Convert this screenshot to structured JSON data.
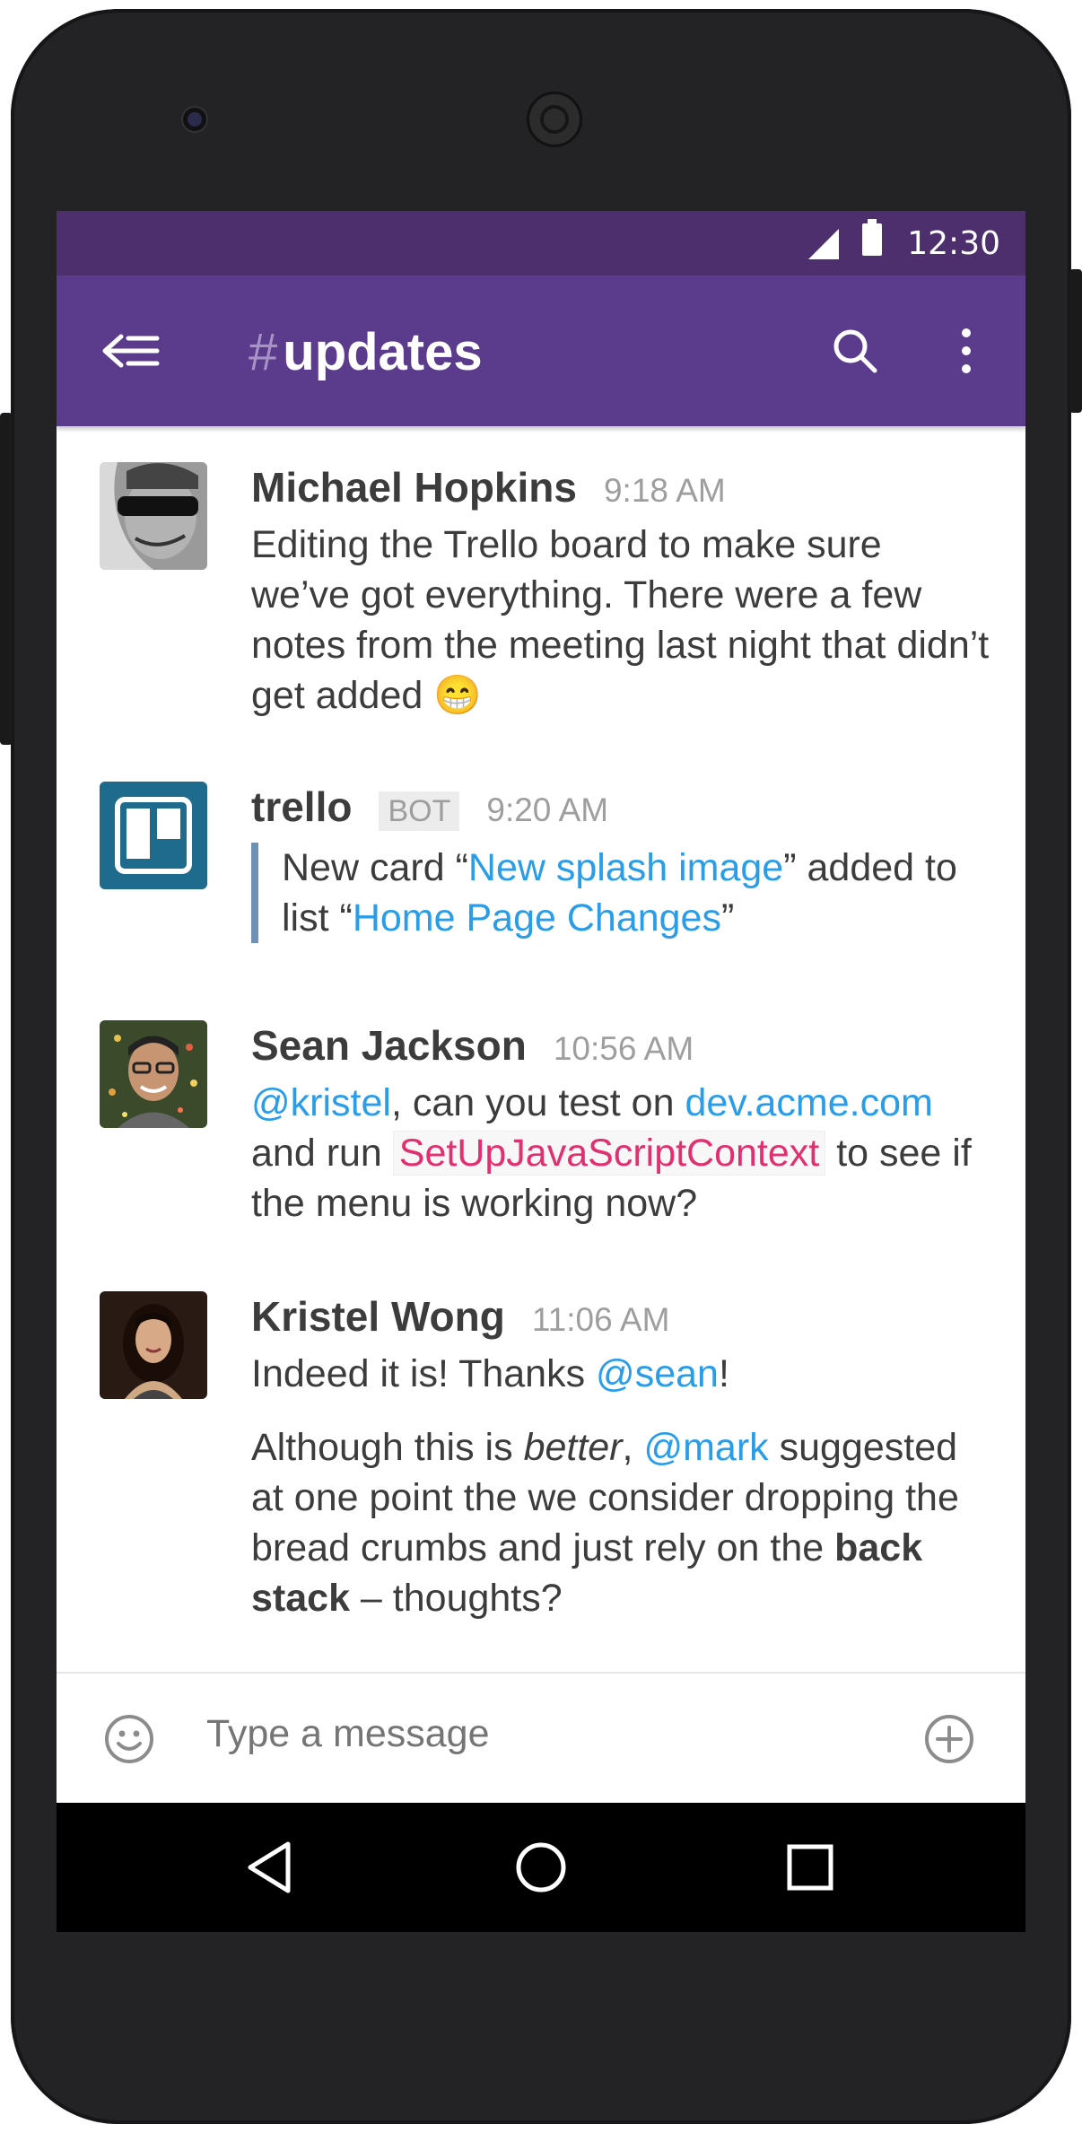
{
  "status_bar": {
    "time": "12:30"
  },
  "app_bar": {
    "hash": "#",
    "channel": "updates"
  },
  "messages": [
    {
      "author": "Michael Hopkins",
      "time": "9:18 AM",
      "text": "Editing the Trello board to make sure we’ve got everything. There were a few notes from the meeting last night that didn’t get added",
      "emoji": "😁"
    },
    {
      "author": "trello",
      "badge": "BOT",
      "time": "9:20 AM",
      "t1": "New card “",
      "link1": "New splash image",
      "t2": "” added to list “",
      "link2": "Home Page Changes",
      "t3": "”"
    },
    {
      "author": "Sean Jackson",
      "time": "10:56 AM",
      "mention": "@kristel",
      "t1": ", can you test on ",
      "link": "dev.acme.com",
      "t2": " and run ",
      "code": "SetUpJavaScriptContext",
      "t3": " to see if the menu is working now?"
    },
    {
      "author": "Kristel Wong",
      "time": "11:06 AM",
      "p1_t1": "Indeed it is! Thanks ",
      "p1_mention": "@sean",
      "p1_t2": "!",
      "p2_t1": "Although this is ",
      "p2_em": "better",
      "p2_t2": ", ",
      "p2_mention": "@mark",
      "p2_t3": " suggested at one point the we consider dropping the bread crumbs and just rely on the ",
      "p2_bold": "back stack",
      "p2_t4": " – thoughts?"
    }
  ],
  "composer": {
    "placeholder": "Type a message"
  },
  "colors": {
    "status_bar": "#4d2f6e",
    "app_bar": "#5b3b8b",
    "link": "#2a9de8",
    "code": "#e0306f"
  }
}
